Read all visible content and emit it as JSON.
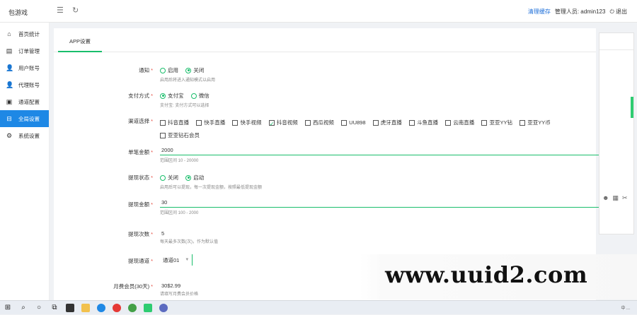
{
  "header": {
    "logo": "包游戏",
    "clear_cache": "清理缓存",
    "admin_label": "管理人员: admin123",
    "logout": "退出"
  },
  "sidebar": {
    "items": [
      {
        "label": "首页统计",
        "icon": "home-icon",
        "active": false
      },
      {
        "label": "订单管理",
        "icon": "clipboard-icon",
        "active": false
      },
      {
        "label": "用户账号",
        "icon": "user-icon",
        "active": false
      },
      {
        "label": "代理账号",
        "icon": "agent-icon",
        "active": false
      },
      {
        "label": "通道配置",
        "icon": "channel-icon",
        "active": false
      },
      {
        "label": "全局设置",
        "icon": "settings-icon",
        "active": true
      },
      {
        "label": "系统设置",
        "icon": "gear-icon",
        "active": false
      }
    ]
  },
  "tab": {
    "label": "APP设置"
  },
  "form": {
    "f1": {
      "label": "通知",
      "options": [
        "启用",
        "关闭"
      ],
      "selected": 1,
      "hint": "启用后将进入通知模式以启用"
    },
    "f2": {
      "label": "支付方式",
      "options": [
        "支付宝",
        "微信"
      ],
      "selected": 0,
      "hint": "支付宝: 支付方式可以选择"
    },
    "f3": {
      "label": "渠道选择",
      "options": [
        "抖音直播",
        "快手直播",
        "快手视频",
        "抖音视频",
        "西瓜视频",
        "UU898",
        "虎牙直播",
        "斗鱼直播",
        "云南直播",
        "亚亚YY钻",
        "亚亚YY币",
        "亚亚钻石会员"
      ],
      "checked": [
        3
      ]
    },
    "f4": {
      "label": "单笔金额",
      "value": "2000",
      "hint": "范围区间 10 - 20000"
    },
    "f5": {
      "label": "提现状态",
      "options": [
        "关闭",
        "启动"
      ],
      "selected": 1,
      "hint": "启用后可以提现，每一次提现金额，按照最低提现金额"
    },
    "f6": {
      "label": "提现金额",
      "value": "30",
      "hint": "范围区间 100 - 2000"
    },
    "f7": {
      "label": "提现次数",
      "value": "5",
      "hint": "每天最多次数(次)，作为默认值"
    },
    "f8": {
      "label": "提现通道",
      "value": "通道01"
    },
    "f9": {
      "label": "月费会员(30天)",
      "value": "30$2.99",
      "hint": "请填写月费会员价格"
    }
  },
  "watermark": "www.uuid2.com",
  "taskbar": {
    "icons": [
      "windows-icon",
      "search-icon",
      "cortana-icon",
      "task-view-icon",
      "app-icon",
      "folder-icon",
      "edge-icon",
      "chrome-icon",
      "browser-icon",
      "wechat-icon",
      "globe-icon"
    ],
    "tray_text": "中 ..."
  }
}
